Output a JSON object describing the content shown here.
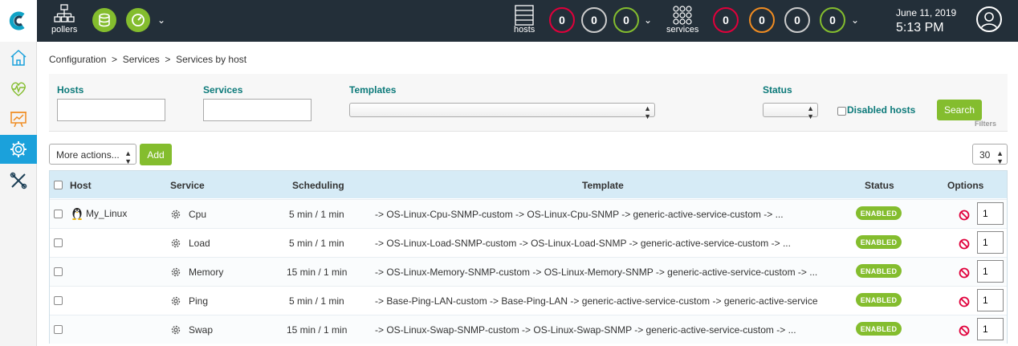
{
  "topbar": {
    "pollers_label": "pollers",
    "hosts_label": "hosts",
    "services_label": "services",
    "host_counts": [
      {
        "value": "0",
        "color": "#e0003b"
      },
      {
        "value": "0",
        "color": "#cccccc"
      },
      {
        "value": "0",
        "color": "#84bd2e"
      }
    ],
    "service_counts": [
      {
        "value": "0",
        "color": "#e0003b"
      },
      {
        "value": "0",
        "color": "#f08c21"
      },
      {
        "value": "0",
        "color": "#cccccc"
      },
      {
        "value": "0",
        "color": "#84bd2e"
      }
    ],
    "date": "June 11, 2019",
    "time": "5:13 PM"
  },
  "sidebar": {
    "items": [
      {
        "icon": "home-icon"
      },
      {
        "icon": "monitoring-icon"
      },
      {
        "icon": "reporting-icon"
      },
      {
        "icon": "configuration-gear-icon",
        "active": true
      },
      {
        "icon": "administration-tools-icon"
      }
    ]
  },
  "breadcrumb": "Configuration  >  Services  >  Services by host",
  "filters": {
    "hosts_label": "Hosts",
    "hosts_value": "",
    "services_label": "Services",
    "services_value": "",
    "templates_label": "Templates",
    "templates_value": "",
    "status_label": "Status",
    "status_value": "",
    "disabled_hosts_label": "Disabled hosts",
    "search_label": "Search",
    "filters_link": "Filters"
  },
  "actions": {
    "more_actions": "More actions...",
    "add": "Add",
    "page_size": "30"
  },
  "table": {
    "columns": [
      "Host",
      "Service",
      "Scheduling",
      "Template",
      "Status",
      "Options"
    ],
    "rows": [
      {
        "host": "My_Linux",
        "service": "Cpu",
        "scheduling": "5 min / 1 min",
        "template": "-> OS-Linux-Cpu-SNMP-custom -> OS-Linux-Cpu-SNMP -> generic-active-service-custom -> ...",
        "status": "ENABLED",
        "dup": "1"
      },
      {
        "host": "",
        "service": "Load",
        "scheduling": "5 min / 1 min",
        "template": "-> OS-Linux-Load-SNMP-custom -> OS-Linux-Load-SNMP -> generic-active-service-custom -> ...",
        "status": "ENABLED",
        "dup": "1"
      },
      {
        "host": "",
        "service": "Memory",
        "scheduling": "15 min / 1 min",
        "template": "-> OS-Linux-Memory-SNMP-custom -> OS-Linux-Memory-SNMP -> generic-active-service-custom -> ...",
        "status": "ENABLED",
        "dup": "1"
      },
      {
        "host": "",
        "service": "Ping",
        "scheduling": "5 min / 1 min",
        "template": "-> Base-Ping-LAN-custom -> Base-Ping-LAN -> generic-active-service-custom -> generic-active-service",
        "status": "ENABLED",
        "dup": "1"
      },
      {
        "host": "",
        "service": "Swap",
        "scheduling": "15 min / 1 min",
        "template": "-> OS-Linux-Swap-SNMP-custom -> OS-Linux-Swap-SNMP -> generic-active-service-custom -> ...",
        "status": "ENABLED",
        "dup": "1"
      }
    ]
  }
}
